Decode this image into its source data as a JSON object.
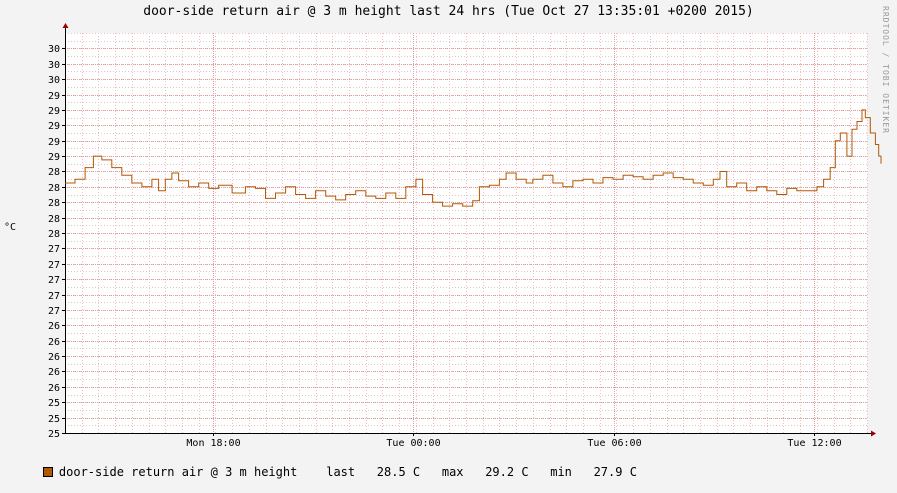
{
  "chart_data": {
    "type": "line",
    "title": "door-side return air @ 3 m height last 24 hrs (Tue Oct 27 13:35:01 +0200 2015)",
    "watermark": "RRDTOOL / TOBI OETIKER",
    "ylabel": "°C",
    "ylim": [
      25.0,
      30.2
    ],
    "yticks": [
      {
        "v": 25.0,
        "label": "25"
      },
      {
        "v": 25.2,
        "label": "25"
      },
      {
        "v": 25.4,
        "label": "25"
      },
      {
        "v": 25.6,
        "label": "26"
      },
      {
        "v": 25.8,
        "label": "26"
      },
      {
        "v": 26.0,
        "label": "26"
      },
      {
        "v": 26.2,
        "label": "26"
      },
      {
        "v": 26.4,
        "label": "26"
      },
      {
        "v": 26.6,
        "label": "27"
      },
      {
        "v": 26.8,
        "label": "27"
      },
      {
        "v": 27.0,
        "label": "27"
      },
      {
        "v": 27.2,
        "label": "27"
      },
      {
        "v": 27.4,
        "label": "27"
      },
      {
        "v": 27.6,
        "label": "28"
      },
      {
        "v": 27.8,
        "label": "28"
      },
      {
        "v": 28.0,
        "label": "28"
      },
      {
        "v": 28.2,
        "label": "28"
      },
      {
        "v": 28.4,
        "label": "28"
      },
      {
        "v": 28.6,
        "label": "29"
      },
      {
        "v": 28.8,
        "label": "29"
      },
      {
        "v": 29.0,
        "label": "29"
      },
      {
        "v": 29.2,
        "label": "29"
      },
      {
        "v": 29.4,
        "label": "29"
      },
      {
        "v": 29.6,
        "label": "30"
      },
      {
        "v": 29.8,
        "label": "30"
      },
      {
        "v": 30.0,
        "label": "30"
      }
    ],
    "xlim_hours": [
      -24.0,
      0.0
    ],
    "xticks": [
      {
        "t": -19.58,
        "label": "Mon 18:00"
      },
      {
        "t": -13.58,
        "label": "Tue 00:00"
      },
      {
        "t": -7.58,
        "label": "Tue 06:00"
      },
      {
        "t": -1.58,
        "label": "Tue 12:00"
      }
    ],
    "series": [
      {
        "name": "door-side return air @ 3 m height",
        "color": "#b35806",
        "points": [
          [
            -24.0,
            28.25
          ],
          [
            -23.7,
            28.3
          ],
          [
            -23.4,
            28.45
          ],
          [
            -23.15,
            28.6
          ],
          [
            -22.9,
            28.55
          ],
          [
            -22.6,
            28.45
          ],
          [
            -22.3,
            28.35
          ],
          [
            -22.0,
            28.25
          ],
          [
            -21.7,
            28.2
          ],
          [
            -21.4,
            28.3
          ],
          [
            -21.2,
            28.15
          ],
          [
            -21.0,
            28.3
          ],
          [
            -20.8,
            28.38
          ],
          [
            -20.6,
            28.28
          ],
          [
            -20.3,
            28.2
          ],
          [
            -20.0,
            28.25
          ],
          [
            -19.7,
            28.18
          ],
          [
            -19.4,
            28.22
          ],
          [
            -19.0,
            28.12
          ],
          [
            -18.6,
            28.2
          ],
          [
            -18.3,
            28.18
          ],
          [
            -18.0,
            28.05
          ],
          [
            -17.7,
            28.12
          ],
          [
            -17.4,
            28.2
          ],
          [
            -17.1,
            28.1
          ],
          [
            -16.8,
            28.05
          ],
          [
            -16.5,
            28.15
          ],
          [
            -16.2,
            28.08
          ],
          [
            -15.9,
            28.03
          ],
          [
            -15.6,
            28.1
          ],
          [
            -15.3,
            28.15
          ],
          [
            -15.0,
            28.08
          ],
          [
            -14.7,
            28.05
          ],
          [
            -14.4,
            28.12
          ],
          [
            -14.1,
            28.05
          ],
          [
            -13.8,
            28.2
          ],
          [
            -13.5,
            28.3
          ],
          [
            -13.3,
            28.1
          ],
          [
            -13.0,
            28.0
          ],
          [
            -12.7,
            27.95
          ],
          [
            -12.4,
            27.98
          ],
          [
            -12.1,
            27.95
          ],
          [
            -11.8,
            28.02
          ],
          [
            -11.6,
            28.2
          ],
          [
            -11.3,
            28.22
          ],
          [
            -11.0,
            28.3
          ],
          [
            -10.8,
            28.38
          ],
          [
            -10.5,
            28.3
          ],
          [
            -10.2,
            28.25
          ],
          [
            -10.0,
            28.3
          ],
          [
            -9.7,
            28.35
          ],
          [
            -9.4,
            28.25
          ],
          [
            -9.1,
            28.2
          ],
          [
            -8.8,
            28.28
          ],
          [
            -8.5,
            28.3
          ],
          [
            -8.2,
            28.25
          ],
          [
            -7.9,
            28.32
          ],
          [
            -7.6,
            28.3
          ],
          [
            -7.3,
            28.35
          ],
          [
            -7.0,
            28.33
          ],
          [
            -6.7,
            28.3
          ],
          [
            -6.4,
            28.35
          ],
          [
            -6.1,
            28.38
          ],
          [
            -5.8,
            28.32
          ],
          [
            -5.5,
            28.3
          ],
          [
            -5.2,
            28.25
          ],
          [
            -4.9,
            28.22
          ],
          [
            -4.6,
            28.3
          ],
          [
            -4.4,
            28.4
          ],
          [
            -4.2,
            28.2
          ],
          [
            -3.9,
            28.25
          ],
          [
            -3.6,
            28.15
          ],
          [
            -3.3,
            28.2
          ],
          [
            -3.0,
            28.15
          ],
          [
            -2.7,
            28.1
          ],
          [
            -2.4,
            28.18
          ],
          [
            -2.1,
            28.15
          ],
          [
            -1.8,
            28.15
          ],
          [
            -1.5,
            28.2
          ],
          [
            -1.3,
            28.3
          ],
          [
            -1.1,
            28.45
          ],
          [
            -0.95,
            28.8
          ],
          [
            -0.8,
            28.9
          ],
          [
            -0.6,
            28.6
          ],
          [
            -0.45,
            28.95
          ],
          [
            -0.3,
            29.05
          ],
          [
            -0.15,
            29.2
          ],
          [
            -0.05,
            29.1
          ],
          [
            0.1,
            28.9
          ],
          [
            0.25,
            28.75
          ],
          [
            0.35,
            28.6
          ],
          [
            0.42,
            28.5
          ]
        ]
      }
    ],
    "legend": {
      "name": "door-side return air @ 3 m height",
      "last": "last   28.5 C",
      "max": "max   29.2 C",
      "min": "min   27.9 C"
    },
    "grid": true
  }
}
